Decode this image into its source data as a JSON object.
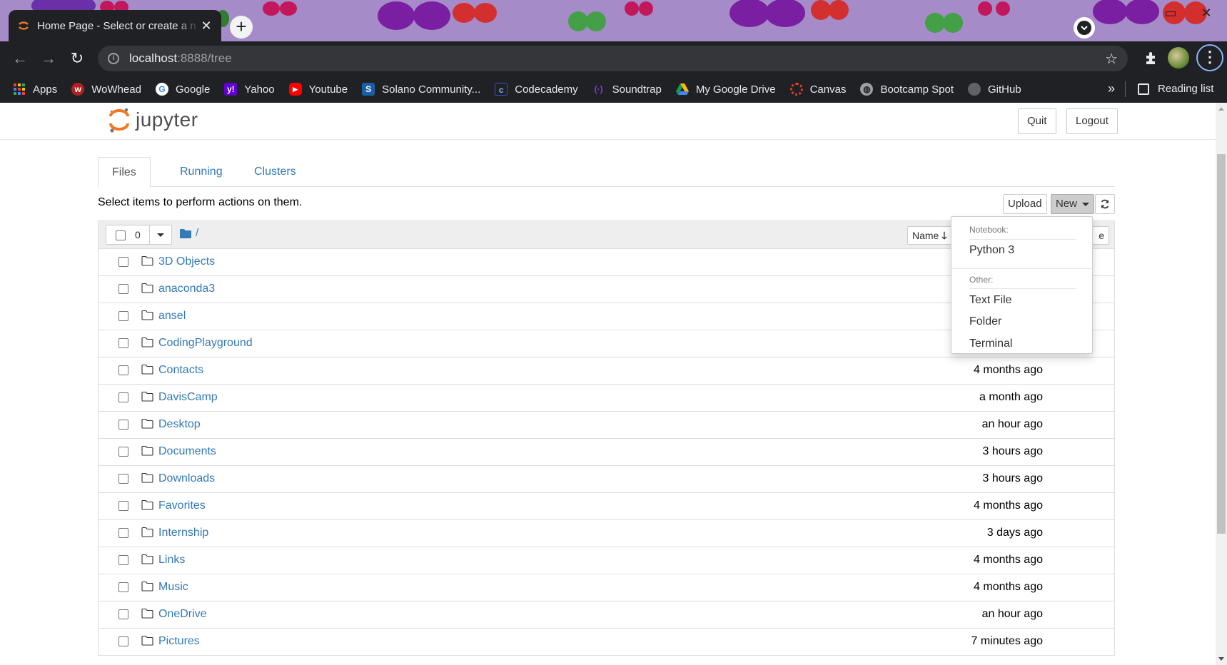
{
  "browser": {
    "tab_title": "Home Page - Select or create a n",
    "url_host": "localhost",
    "url_rest": ":8888/tree",
    "bookmarks": [
      {
        "label": "Apps",
        "icon": "apps-grid-icon",
        "color": "#ea4335"
      },
      {
        "label": "WoWhead",
        "icon": "wowhead-icon",
        "color": "#b22222"
      },
      {
        "label": "Google",
        "icon": "google-icon",
        "color": "#4285f4"
      },
      {
        "label": "Yahoo",
        "icon": "yahoo-icon",
        "color": "#6001d2"
      },
      {
        "label": "Youtube",
        "icon": "youtube-icon",
        "color": "#ff0000"
      },
      {
        "label": "Solano Community...",
        "icon": "solano-icon",
        "color": "#1a5ea8"
      },
      {
        "label": "Codecademy",
        "icon": "codecademy-icon",
        "color": "#3c4fc2"
      },
      {
        "label": "Soundtrap",
        "icon": "soundtrap-icon",
        "color": "#7b3fe4"
      },
      {
        "label": "My Google Drive",
        "icon": "google-drive-icon",
        "color": "#0f9d58"
      },
      {
        "label": "Canvas",
        "icon": "canvas-icon",
        "color": "#e13f2b"
      },
      {
        "label": "Bootcamp Spot",
        "icon": "globe-icon",
        "color": "#9aa0a6"
      },
      {
        "label": "GitHub",
        "icon": "github-icon",
        "color": "#5f6368"
      }
    ],
    "more_bookmarks": "»",
    "reading_list": "Reading list"
  },
  "jupyter": {
    "logo_text": "jupyter",
    "quit_label": "Quit",
    "logout_label": "Logout",
    "tabs": [
      "Files",
      "Running",
      "Clusters"
    ],
    "hint": "Select items to perform actions on them.",
    "upload_label": "Upload",
    "new_label": "New",
    "selected_count": "0",
    "breadcrumb": "/",
    "sort_name_label": "Name",
    "modified_label_partial": "e",
    "files": [
      {
        "name": "3D Objects",
        "modified": ""
      },
      {
        "name": "anaconda3",
        "modified": ""
      },
      {
        "name": "ansel",
        "modified": ""
      },
      {
        "name": "CodingPlayground",
        "modified": ""
      },
      {
        "name": "Contacts",
        "modified": "4 months ago"
      },
      {
        "name": "DavisCamp",
        "modified": "a month ago"
      },
      {
        "name": "Desktop",
        "modified": "an hour ago"
      },
      {
        "name": "Documents",
        "modified": "3 hours ago"
      },
      {
        "name": "Downloads",
        "modified": "3 hours ago"
      },
      {
        "name": "Favorites",
        "modified": "4 months ago"
      },
      {
        "name": "Internship",
        "modified": "3 days ago"
      },
      {
        "name": "Links",
        "modified": "4 months ago"
      },
      {
        "name": "Music",
        "modified": "4 months ago"
      },
      {
        "name": "OneDrive",
        "modified": "an hour ago"
      },
      {
        "name": "Pictures",
        "modified": "7 minutes ago"
      }
    ],
    "new_menu": {
      "notebook_header": "Notebook:",
      "python_item": "Python 3",
      "other_header": "Other:",
      "text_file_item": "Text File",
      "folder_item": "Folder",
      "terminal_item": "Terminal"
    }
  },
  "colors": {
    "tab_strip": "#a58bc8",
    "chrome_dark": "#202124",
    "link_blue": "#337ab7",
    "jupyter_orange": "#f37726"
  }
}
